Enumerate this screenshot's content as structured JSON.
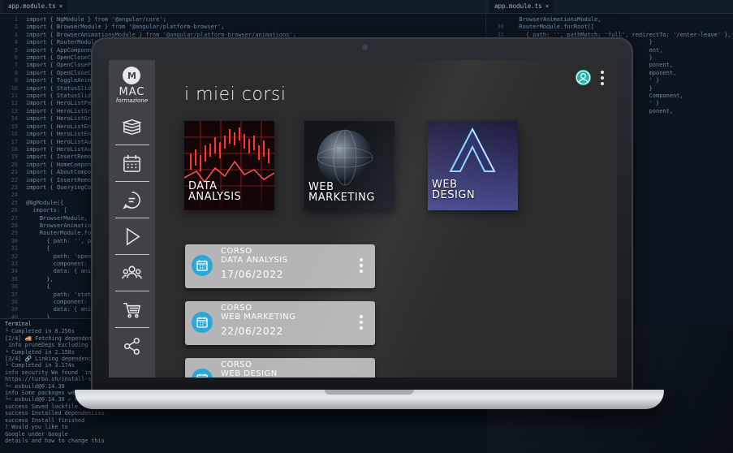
{
  "editor": {
    "tab_left": "app.module.ts",
    "tab_right": "app.module.ts",
    "tab_close": "×",
    "lines": [
      {
        "n": "1",
        "t": "import { NgModule } from '@angular/core';"
      },
      {
        "n": "2",
        "t": "import { BrowserModule } from '@angular/platform-browser';"
      },
      {
        "n": "3",
        "t": "import { BrowserAnimationsModule } from '@angular/platform-browser/animations';"
      },
      {
        "n": "4",
        "t": "import { RouterModule } from"
      },
      {
        "n": "5",
        "t": "import { AppComponent } from"
      },
      {
        "n": "6",
        "t": "import { OpenCloseComponent"
      },
      {
        "n": "7",
        "t": "import { OpenClosePageComp"
      },
      {
        "n": "8",
        "t": "import { OpenCloseChildCom"
      },
      {
        "n": "9",
        "t": "import { ToggleAnimationsP"
      },
      {
        "n": "10",
        "t": "import { StatusSliderComp"
      },
      {
        "n": "11",
        "t": "import { StatusSliderPage"
      },
      {
        "n": "12",
        "t": "import { HeroListPageComp"
      },
      {
        "n": "13",
        "t": "import { HeroListGroupPag"
      },
      {
        "n": "14",
        "t": "import { HeroListGroupsCo"
      },
      {
        "n": "15",
        "t": "import { HeroListEnterLea"
      },
      {
        "n": "16",
        "t": "import { HeroListEnterLea"
      },
      {
        "n": "17",
        "t": "import { HeroListAutoCalc"
      },
      {
        "n": "18",
        "t": "import { HeroListAutoCo"
      },
      {
        "n": "19",
        "t": "import { InsertRemoveCom"
      },
      {
        "n": "20",
        "t": "import { HomeComponent }"
      },
      {
        "n": "21",
        "t": "import { AboutComponent }"
      },
      {
        "n": "22",
        "t": "import { InsertRemoveComp"
      },
      {
        "n": "23",
        "t": "import { QueryingComponent"
      },
      {
        "n": "24",
        "t": ""
      },
      {
        "n": "25",
        "t": "@NgModule({"
      },
      {
        "n": "26",
        "t": "  imports: ["
      },
      {
        "n": "27",
        "t": "    BrowserModule,"
      },
      {
        "n": "28",
        "t": "    BrowserAnimationsModule,"
      },
      {
        "n": "29",
        "t": "    RouterModule.forRoot(["
      },
      {
        "n": "30",
        "t": "      { path: '', pathMat"
      },
      {
        "n": "31",
        "t": "      {"
      },
      {
        "n": "32",
        "t": "        path: 'open-close"
      },
      {
        "n": "33",
        "t": "        component: OpenCl"
      },
      {
        "n": "34",
        "t": "        data: { animation"
      },
      {
        "n": "35",
        "t": "      },"
      },
      {
        "n": "36",
        "t": "      {"
      },
      {
        "n": "37",
        "t": "        path: 'status',"
      },
      {
        "n": "38",
        "t": "        component: Status"
      },
      {
        "n": "39",
        "t": "        data: { animation"
      },
      {
        "n": "40",
        "t": "      },"
      },
      {
        "n": "41",
        "t": "      {"
      }
    ],
    "right_lines": [
      {
        "n": "",
        "t": "  BrowserAnimationsModule,"
      },
      {
        "n": "30",
        "t": "  RouterModule.forRoot(["
      },
      {
        "n": "31",
        "t": "    { path: '', pathMatch: 'full', redirectTo: '/enter-leave' },"
      },
      {
        "n": "",
        "t": ""
      },
      {
        "n": "",
        "t": ""
      },
      {
        "n": "",
        "t": ""
      },
      {
        "n": "",
        "t": ""
      },
      {
        "n": "",
        "t": "                                        }"
      },
      {
        "n": "",
        "t": ""
      },
      {
        "n": "",
        "t": ""
      },
      {
        "n": "",
        "t": ""
      },
      {
        "n": "",
        "t": "                                        ent,"
      },
      {
        "n": "",
        "t": ""
      },
      {
        "n": "",
        "t": "                                        }"
      },
      {
        "n": "",
        "t": ""
      },
      {
        "n": "",
        "t": ""
      },
      {
        "n": "",
        "t": "                                        ponent,"
      },
      {
        "n": "",
        "t": ""
      },
      {
        "n": "",
        "t": ""
      },
      {
        "n": "",
        "t": ""
      },
      {
        "n": "",
        "t": "                                        mponent,"
      },
      {
        "n": "",
        "t": "                                        ' }"
      },
      {
        "n": "",
        "t": ""
      },
      {
        "n": "",
        "t": ""
      },
      {
        "n": "",
        "t": "                                        }"
      },
      {
        "n": "",
        "t": ""
      },
      {
        "n": "",
        "t": ""
      },
      {
        "n": "",
        "t": ""
      },
      {
        "n": "",
        "t": ""
      },
      {
        "n": "",
        "t": ""
      },
      {
        "n": "",
        "t": "                                        Component,"
      },
      {
        "n": "",
        "t": "                                        ' }"
      },
      {
        "n": "",
        "t": ""
      },
      {
        "n": "",
        "t": ""
      },
      {
        "n": "",
        "t": "                                        ponent,"
      }
    ]
  },
  "terminal": {
    "title": "Terminal",
    "lines": [
      "└ Completed in 8.256s",
      "[2/4] 🚚 Fetching dependencies...",
      " info pruneDeps Excluding 14 d",
      "└ Completed in 2.158s",
      "[3/4] 🔗 Linking dependencies...",
      "└ Completed in 3.174s",
      "info security We found `install",
      "https://turbo.sh/install-script",
      "└─ esbuild@0.14.38",
      "info Some packages were automat",
      "└─ esbuild@0.14.38 ✓ esbuild@0.",
      "",
      "success Saved lockfile.",
      "success Installed dependencies.",
      "",
      "success Install finished",
      "? Would you like to",
      "Google under Google",
      "details and how to change this"
    ]
  },
  "app": {
    "logo_mark": "M",
    "logo_name": "MAC",
    "logo_sub": "formazione",
    "nav": [
      {
        "name": "nav-courses",
        "icon": "books-icon"
      },
      {
        "name": "nav-calendar",
        "icon": "calendar-icon"
      },
      {
        "name": "nav-chat",
        "icon": "chat-icon"
      },
      {
        "name": "nav-video",
        "icon": "play-icon"
      },
      {
        "name": "nav-community",
        "icon": "users-icon"
      },
      {
        "name": "nav-shop",
        "icon": "cart-icon"
      },
      {
        "name": "nav-share",
        "icon": "share-icon"
      }
    ],
    "page_title": "i miei corsi",
    "courses": [
      {
        "line1": "DATA",
        "line2": "ANALYSIS"
      },
      {
        "line1": "WEB",
        "line2": "MARKETING"
      },
      {
        "line1": "WEB",
        "line2": "DESIGN"
      }
    ],
    "lessons": [
      {
        "kind": "CORSO",
        "name": "DATA ANALYSIS",
        "date": "17/06/2022"
      },
      {
        "kind": "CORSO",
        "name": "WEB MARKETING",
        "date": "22/06/2022"
      },
      {
        "kind": "CORSO",
        "name": "WEB DESIGN",
        "date": ""
      }
    ],
    "colors": {
      "accent": "#2da7d6",
      "avatar": "#1fb7a6",
      "sidebar": "#414246",
      "background": "#2c2c2e",
      "card": "#b5b5b8"
    }
  }
}
